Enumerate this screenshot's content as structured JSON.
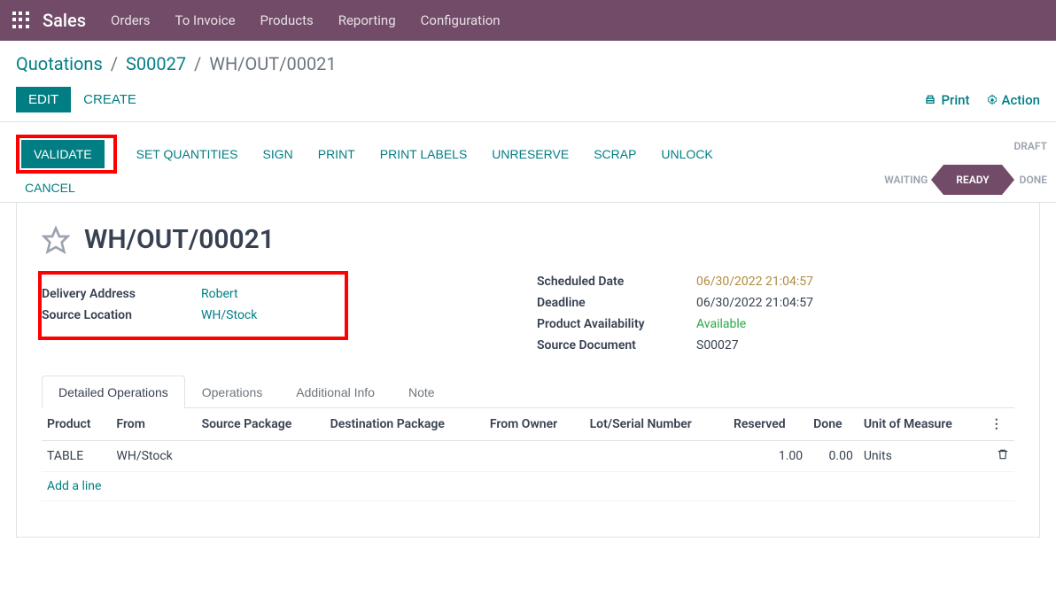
{
  "app_name": "Sales",
  "nav": [
    "Orders",
    "To Invoice",
    "Products",
    "Reporting",
    "Configuration"
  ],
  "breadcrumb": {
    "a": "Quotations",
    "b": "S00027",
    "current": "WH/OUT/00021"
  },
  "buttons": {
    "edit": "EDIT",
    "create": "CREATE",
    "print": "Print",
    "action": "Action"
  },
  "actions": {
    "validate": "VALIDATE",
    "set_qty": "SET QUANTITIES",
    "sign": "SIGN",
    "print": "PRINT",
    "print_labels": "PRINT LABELS",
    "unreserve": "UNRESERVE",
    "scrap": "SCRAP",
    "unlock": "UNLOCK",
    "cancel": "CANCEL"
  },
  "status": {
    "draft": "DRAFT",
    "waiting": "WAITING",
    "ready": "READY",
    "done": "DONE"
  },
  "title": "WH/OUT/00021",
  "left_fields": {
    "delivery_label": "Delivery Address",
    "delivery_value": "Robert",
    "source_loc_label": "Source Location",
    "source_loc_value": "WH/Stock"
  },
  "right_fields": {
    "sched_label": "Scheduled Date",
    "sched_value": "06/30/2022 21:04:57",
    "deadline_label": "Deadline",
    "deadline_value": "06/30/2022 21:04:57",
    "avail_label": "Product Availability",
    "avail_value": "Available",
    "source_doc_label": "Source Document",
    "source_doc_value": "S00027"
  },
  "tabs": [
    "Detailed Operations",
    "Operations",
    "Additional Info",
    "Note"
  ],
  "table": {
    "headers": [
      "Product",
      "From",
      "Source Package",
      "Destination Package",
      "From Owner",
      "Lot/Serial Number",
      "Reserved",
      "Done",
      "Unit of Measure"
    ],
    "row": {
      "product": "TABLE",
      "from": "WH/Stock",
      "reserved": "1.00",
      "done": "0.00",
      "uom": "Units"
    },
    "add_line": "Add a line"
  }
}
